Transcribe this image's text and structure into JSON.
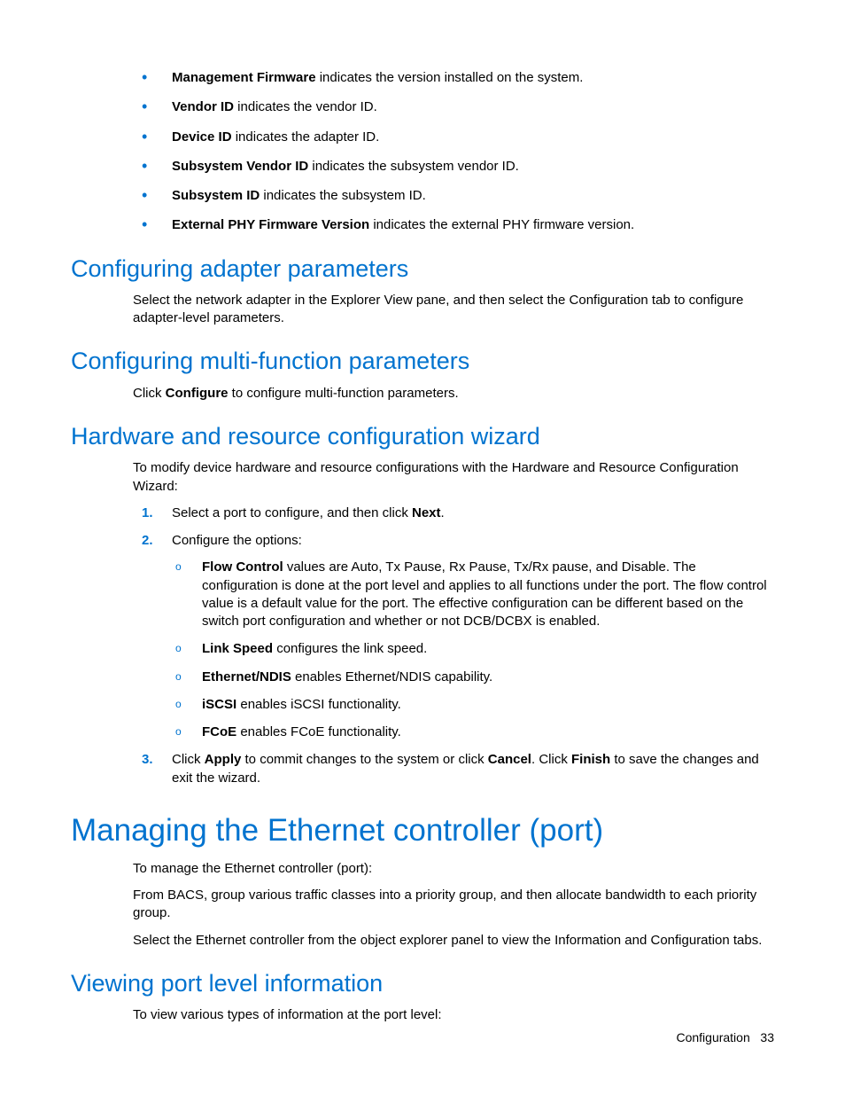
{
  "bullets_top": [
    {
      "term": "Management Firmware",
      "desc": " indicates the version installed on the system."
    },
    {
      "term": "Vendor ID",
      "desc": " indicates the vendor ID."
    },
    {
      "term": "Device ID",
      "desc": " indicates the adapter ID."
    },
    {
      "term": "Subsystem Vendor ID",
      "desc": " indicates the subsystem vendor ID."
    },
    {
      "term": "Subsystem ID",
      "desc": " indicates the subsystem ID."
    },
    {
      "term": "External PHY Firmware Version",
      "desc": " indicates the external PHY firmware version."
    }
  ],
  "sec1": {
    "title": "Configuring adapter parameters",
    "body": "Select the network adapter in the Explorer View pane, and then select the Configuration tab to configure adapter-level parameters."
  },
  "sec2": {
    "title": "Configuring multi-function parameters",
    "body_pre": "Click ",
    "body_bold": "Configure",
    "body_post": " to configure multi-function parameters."
  },
  "sec3": {
    "title": "Hardware and resource configuration wizard",
    "intro": "To modify device hardware and resource configurations with the Hardware and Resource Configuration Wizard:",
    "step1_pre": "Select a port to configure, and then click ",
    "step1_bold": "Next",
    "step1_post": ".",
    "step2": "Configure the options:",
    "opts": [
      {
        "term": "Flow Control",
        "desc": " values are Auto, Tx Pause, Rx Pause, Tx/Rx pause, and Disable. The configuration is done at the port level and applies to all functions under the port. The flow control value is a default value for the port. The effective configuration can be different based on the switch port configuration and whether or not DCB/DCBX is enabled."
      },
      {
        "term": "Link Speed",
        "desc": " configures the link speed."
      },
      {
        "term": "Ethernet/NDIS",
        "desc": " enables Ethernet/NDIS capability."
      },
      {
        "term": "iSCSI",
        "desc": " enables iSCSI functionality."
      },
      {
        "term": "FCoE",
        "desc": " enables FCoE functionality."
      }
    ],
    "step3_1": "Click ",
    "step3_b1": "Apply",
    "step3_2": " to commit changes to the system or click ",
    "step3_b2": "Cancel",
    "step3_3": ". Click ",
    "step3_b3": "Finish",
    "step3_4": " to save the changes and exit the wizard."
  },
  "sec4": {
    "title": "Managing the Ethernet controller (port)",
    "p1": "To manage the Ethernet controller (port):",
    "p2": "From BACS, group various traffic classes into a priority group, and then allocate bandwidth to each priority group.",
    "p3": "Select the Ethernet controller from the object explorer panel to view the Information and Configuration tabs."
  },
  "sec5": {
    "title": "Viewing port level information",
    "p1": "To view various types of information at the port level:"
  },
  "footer": {
    "section": "Configuration",
    "page": "33"
  }
}
